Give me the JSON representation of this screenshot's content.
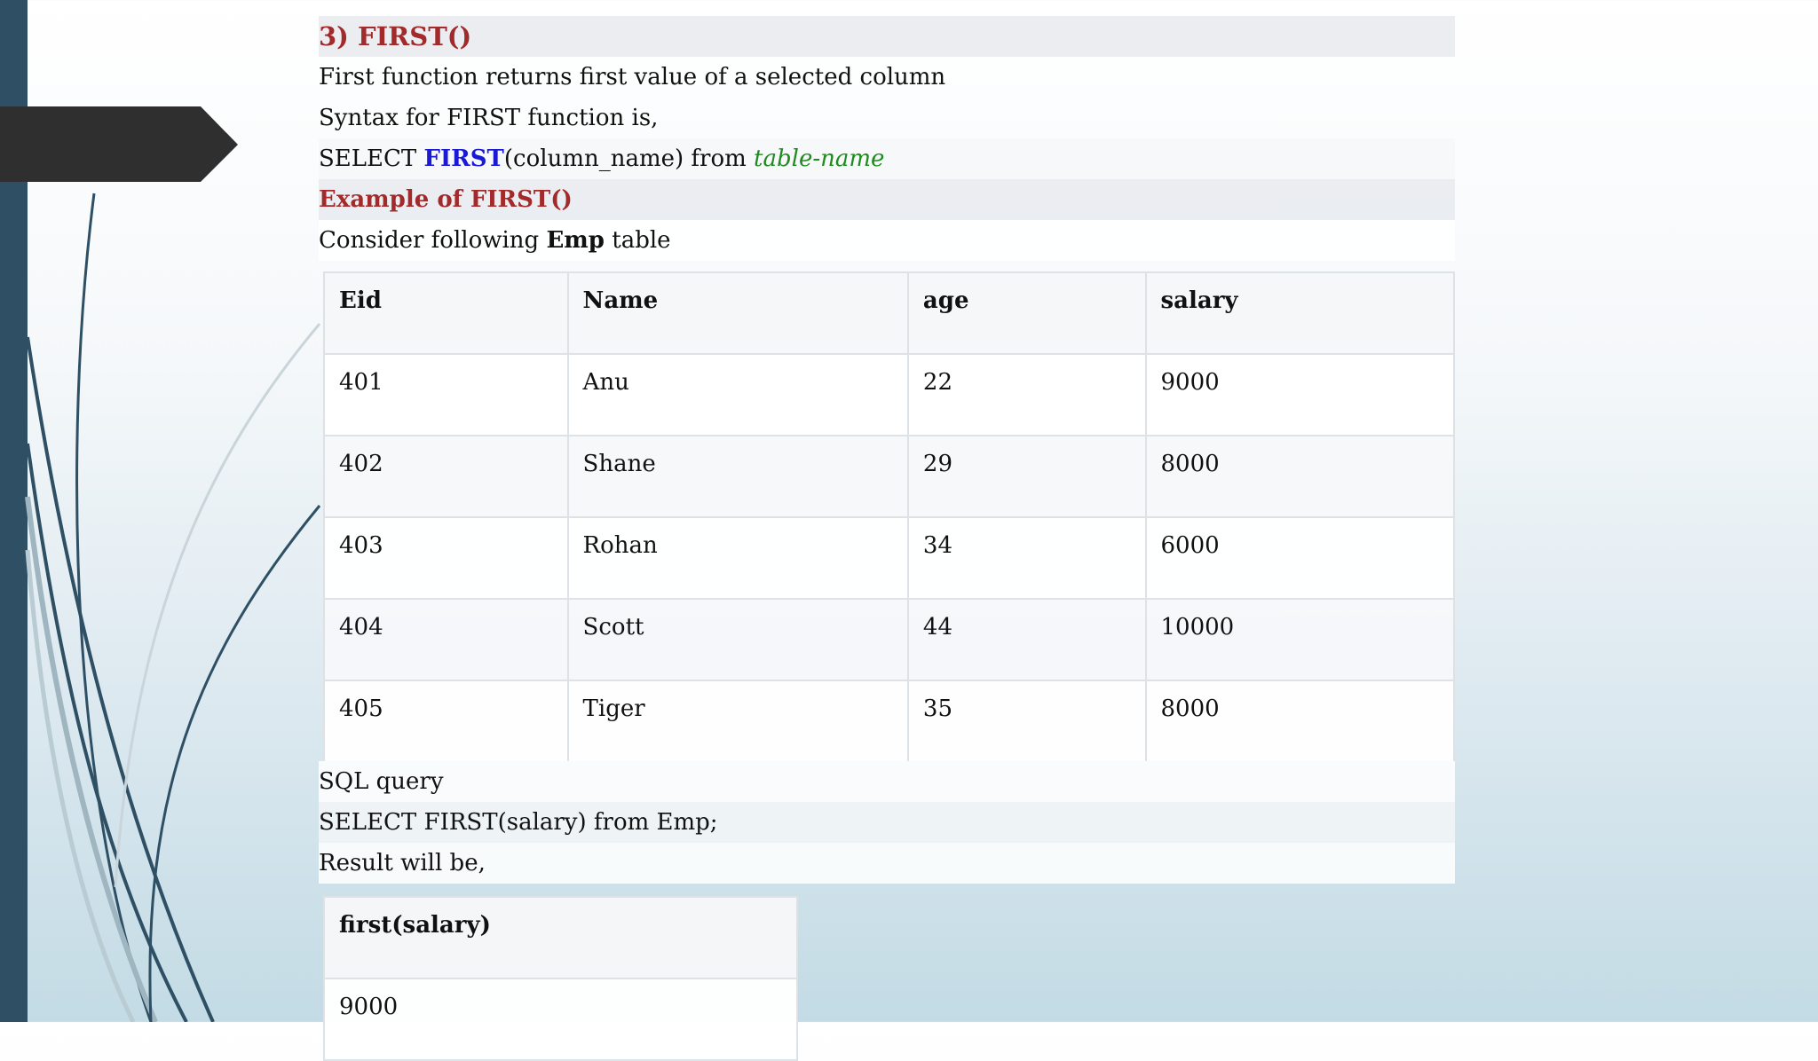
{
  "heading": "3) FIRST()",
  "description": "First function returns first value of a selected column",
  "syntax_intro": "Syntax for FIRST function is,",
  "syntax": {
    "select": "SELECT ",
    "func": "FIRST",
    "args": "(column_name) from ",
    "table": "table-name"
  },
  "example_heading": "Example of FIRST()",
  "consider": {
    "prefix": "Consider following ",
    "table_name": "Emp",
    "suffix": " table"
  },
  "emp_table": {
    "headers": [
      "Eid",
      "Name",
      "age",
      "salary"
    ],
    "rows": [
      [
        "401",
        "Anu",
        "22",
        "9000"
      ],
      [
        "402",
        "Shane",
        "29",
        "8000"
      ],
      [
        "403",
        "Rohan",
        "34",
        "6000"
      ],
      [
        "404",
        "Scott",
        "44",
        "10000"
      ],
      [
        "405",
        "Tiger",
        "35",
        "8000"
      ]
    ]
  },
  "sql_query_label": "SQL query",
  "sql_query": "SELECT FIRST(salary) from Emp;",
  "result_label": "Result will be,",
  "result_table": {
    "header": "first(salary)",
    "value": "9000"
  },
  "colors": {
    "heading": "#a32a2a",
    "keyword": "#1a1ad6",
    "italic_table": "#1f8a1f",
    "left_bar": "#2e4f64",
    "arrow_tab": "#2f2f2f"
  }
}
